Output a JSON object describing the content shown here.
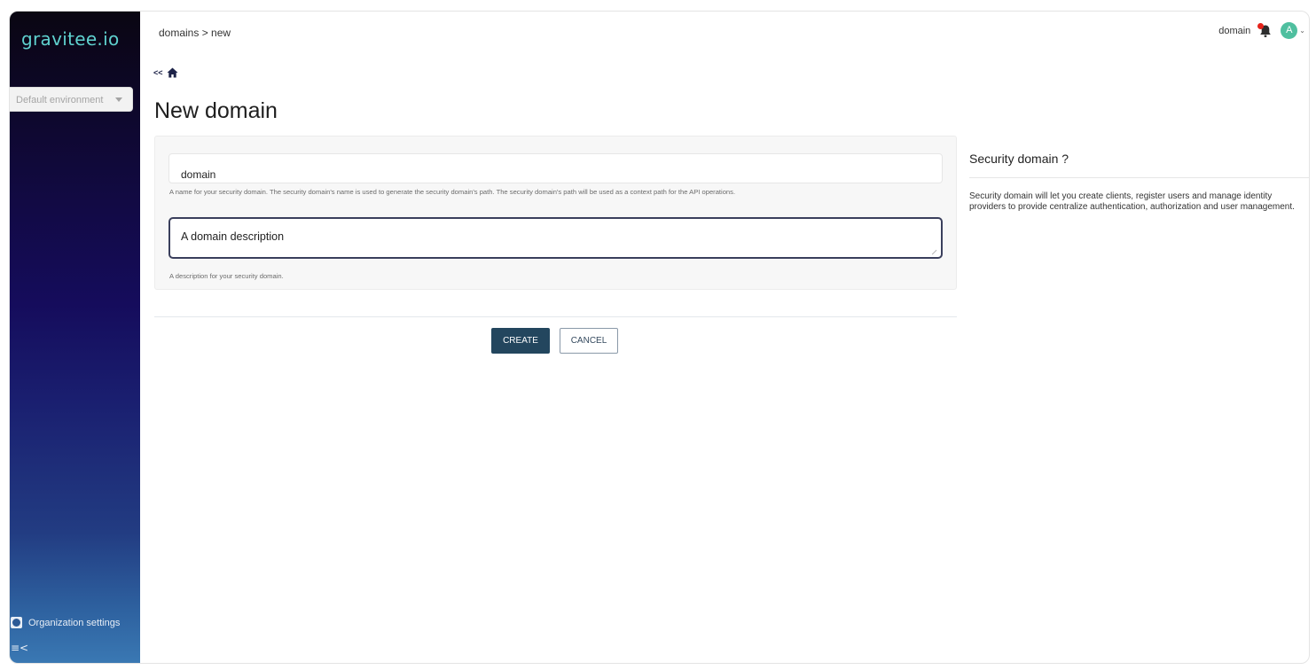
{
  "sidebar": {
    "logo_main": "gravitee",
    "logo_dot": ".",
    "logo_suffix": "io",
    "environment_select": {
      "selected": "Default environment"
    },
    "organization_settings_label": "Organization settings",
    "collapse_icon": "collapse-menu-icon"
  },
  "header": {
    "breadcrumb": "domains > new",
    "current_domain": "domain",
    "notification_icon": "bell-icon",
    "notification_badge_color": "#e5231b",
    "avatar_initial": "A",
    "avatar_color": "#4fbf9f"
  },
  "nav": {
    "back_label": "<<",
    "home_icon": "home-icon"
  },
  "page": {
    "title": "New domain"
  },
  "form": {
    "name_value": "domain",
    "name_hint": "A name for your security domain. The security domain's name is used to generate the security domain's path. The security domain's path will be used as a context path for the API operations.",
    "description_value": "A domain description",
    "description_hint": "A description for your security domain."
  },
  "actions": {
    "create_label": "CREATE",
    "cancel_label": "CANCEL",
    "primary_color": "#23465e"
  },
  "help": {
    "title": "Security domain ?",
    "text": "Security domain will let you create clients, register users and manage identity providers to provide centralize authentication, authorization and user management."
  }
}
